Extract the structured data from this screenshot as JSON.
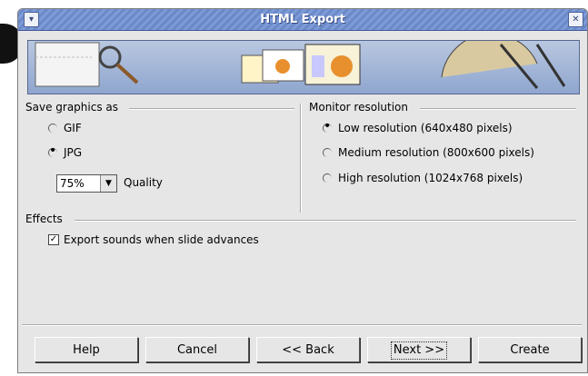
{
  "window": {
    "title": "HTML Export"
  },
  "save_graphics": {
    "label": "Save graphics as",
    "options": [
      {
        "label": "GIF",
        "selected": false
      },
      {
        "label": "JPG",
        "selected": true
      }
    ],
    "quality_value": "75%",
    "quality_label": "Quality"
  },
  "monitor": {
    "label": "Monitor resolution",
    "options": [
      {
        "label": "Low resolution (640x480 pixels)",
        "selected": true
      },
      {
        "label": "Medium resolution (800x600 pixels)",
        "selected": false
      },
      {
        "label": "High resolution (1024x768 pixels)",
        "selected": false
      }
    ]
  },
  "effects": {
    "label": "Effects",
    "export_sounds": {
      "label": "Export sounds when slide advances",
      "checked": true
    }
  },
  "buttons": {
    "help": "Help",
    "cancel": "Cancel",
    "back": "<< Back",
    "next": "Next >>",
    "create": "Create"
  },
  "colors": {
    "titlebar": "#7d9bd8",
    "dialog_bg": "#e6e6e6"
  }
}
